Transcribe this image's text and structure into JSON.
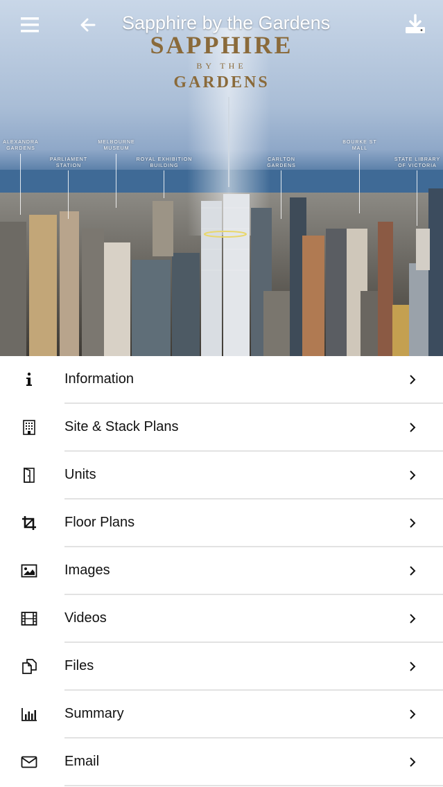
{
  "header": {
    "title": "Sapphire by the Gardens",
    "menu_icon": "hamburger-menu-icon",
    "back_icon": "arrow-left-icon",
    "download_icon": "download-icon"
  },
  "hero": {
    "brand_main": "SAPPHIRE",
    "brand_by": "BY THE",
    "brand_gardens": "GARDENS",
    "landmarks": [
      "ALEXANDRA\nGARDENS",
      "PARLIAMENT\nSTATION",
      "MELBOURNE\nMUSEUM",
      "ROYAL EXHIBITION\nBUILDING",
      "CARLTON\nGARDENS",
      "BOURKE ST\nMALL",
      "STATE LIBRARY\nOF VICTORIA"
    ]
  },
  "menu": {
    "items": [
      {
        "label": "Information",
        "icon": "info-icon"
      },
      {
        "label": "Site & Stack Plans",
        "icon": "building-icon"
      },
      {
        "label": "Units",
        "icon": "door-icon"
      },
      {
        "label": "Floor Plans",
        "icon": "crop-icon"
      },
      {
        "label": "Images",
        "icon": "image-icon"
      },
      {
        "label": "Videos",
        "icon": "film-icon"
      },
      {
        "label": "Files",
        "icon": "files-icon"
      },
      {
        "label": "Summary",
        "icon": "bar-chart-icon"
      },
      {
        "label": "Email",
        "icon": "envelope-icon"
      }
    ],
    "chevron_icon": "chevron-right-icon"
  },
  "colors": {
    "brand_gold": "#8a6a3a",
    "text": "#111111",
    "separator": "#e2e2e2"
  }
}
